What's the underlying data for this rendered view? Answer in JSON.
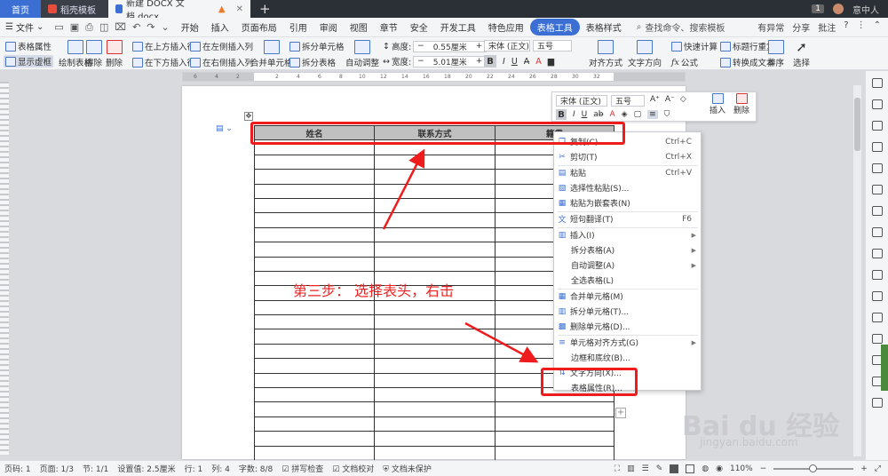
{
  "titlebar": {
    "home_tab": "首页",
    "template_tab": "稻壳模板",
    "doc_tab": "新建 DOCX 文档.docx",
    "new_tab": "+",
    "count_badge": "1",
    "user": "意中人"
  },
  "menubar": {
    "file": "文件",
    "items": [
      "开始",
      "插入",
      "页面布局",
      "引用",
      "审阅",
      "视图",
      "章节",
      "安全",
      "开发工具",
      "特色应用",
      "表格工具",
      "表格样式"
    ],
    "active_item": "表格工具",
    "search": "查找命令、搜索模板",
    "right": [
      "有异常",
      "分享",
      "批注"
    ]
  },
  "ribbon": {
    "table_props": "表格属性",
    "show_gridlines": "显示虚框",
    "draw_table": "绘制表格",
    "erase": "擦除",
    "delete": "删除",
    "summary": "汇总",
    "insert_above": "在上方插入行",
    "insert_below": "在下方插入行",
    "insert_left": "在左侧插入列",
    "insert_right": "在右侧插入列",
    "merge_cells": "合并单元格",
    "split_cells": "拆分单元格",
    "split_table": "拆分表格",
    "auto_fit": "自动调整",
    "height_label": "高度:",
    "height_value": "0.55厘米",
    "width_label": "宽度:",
    "width_value": "5.01厘米",
    "font_name": "宋体 (正文)",
    "font_size": "五号",
    "bold": "B",
    "align": "对齐方式",
    "text_direction": "文字方向",
    "quick_calc": "快速计算",
    "repeat_header": "标题行重复",
    "formula": "公式",
    "convert_text": "转换成文本",
    "sort": "排序",
    "select": "选择"
  },
  "table": {
    "headers": [
      "姓名",
      "联系方式",
      "籍贯"
    ],
    "empty_rows": 22
  },
  "mini_toolbar": {
    "font_name": "宋体 (正文)",
    "font_size": "五号",
    "bold": "B",
    "italic": "I",
    "insert": "插入",
    "delete": "删除"
  },
  "context_menu": {
    "items": [
      {
        "label": "复制(C)",
        "shortcut": "Ctrl+C",
        "icon": "copy-icon"
      },
      {
        "label": "剪切(T)",
        "shortcut": "Ctrl+X",
        "icon": "cut-icon"
      },
      {
        "label": "粘贴",
        "shortcut": "Ctrl+V",
        "icon": "paste-icon"
      },
      {
        "label": "选择性粘贴(S)...",
        "shortcut": "",
        "icon": "paste-special-icon"
      },
      {
        "label": "粘贴为嵌套表(N)",
        "shortcut": "",
        "icon": "paste-nested-icon"
      },
      {
        "label": "短句翻译(T)",
        "shortcut": "F6",
        "icon": "translate-icon"
      },
      {
        "label": "插入(I)",
        "shortcut": "",
        "icon": "insert-icon",
        "submenu": true
      },
      {
        "label": "拆分表格(A)",
        "shortcut": "",
        "icon": "",
        "submenu": true
      },
      {
        "label": "自动调整(A)",
        "shortcut": "",
        "icon": "",
        "submenu": true
      },
      {
        "label": "全选表格(L)",
        "shortcut": "",
        "icon": ""
      },
      {
        "label": "合并单元格(M)",
        "shortcut": "",
        "icon": "merge-icon"
      },
      {
        "label": "拆分单元格(T)...",
        "shortcut": "",
        "icon": "split-icon"
      },
      {
        "label": "删除单元格(D)...",
        "shortcut": "",
        "icon": "delete-cell-icon"
      },
      {
        "label": "单元格对齐方式(G)",
        "shortcut": "",
        "icon": "align-icon",
        "submenu": true
      },
      {
        "label": "边框和底纹(B)...",
        "shortcut": "",
        "icon": ""
      },
      {
        "label": "文字方向(X)...",
        "shortcut": "",
        "icon": "text-direction-icon"
      },
      {
        "label": "表格属性(R)...",
        "shortcut": "",
        "icon": ""
      }
    ]
  },
  "annotation": {
    "text": "第三步：  选择表头，右击",
    "color": "#ee1c1c"
  },
  "watermark": {
    "main": "Bai du 经验",
    "sub": "jingyan.baidu.com"
  },
  "statusbar": {
    "page_num": "页码: 1",
    "pages": "页面: 1/3",
    "section": "节: 1/1",
    "setting": "设置值: 2.5厘米",
    "row": "行: 1",
    "col": "列: 4",
    "wordcount": "字数: 8/8",
    "spell": "拼写检查",
    "proof": "文档校对",
    "protect": "文档未保护",
    "zoom": "110%",
    "zoom_minus": "−",
    "zoom_plus": "+"
  },
  "colors": {
    "accent": "#3b6fd4",
    "annotation_red": "#ee1c1c",
    "header_fill": "#c0c0c0"
  }
}
